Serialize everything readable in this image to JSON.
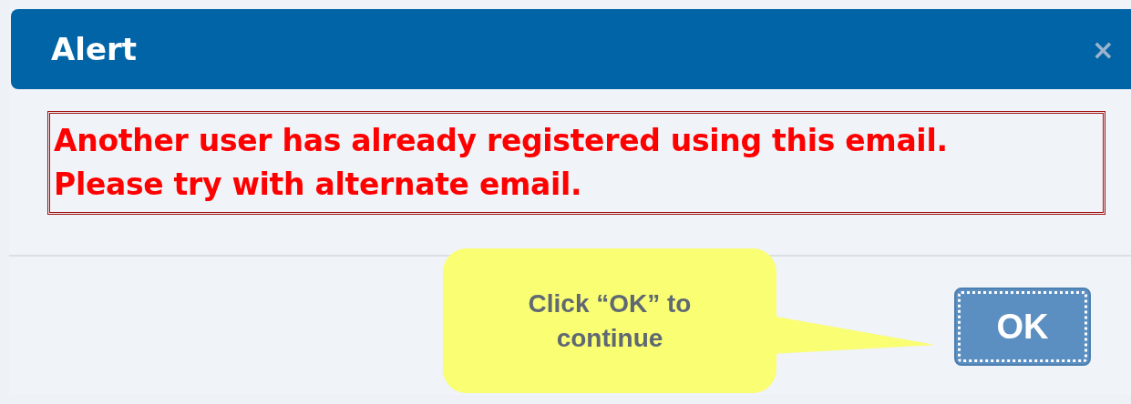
{
  "dialog": {
    "title": "Alert",
    "close": "×",
    "message": "Another user has already registered using this email.\nPlease try with alternate email.",
    "button": "OK",
    "button_focused": true
  },
  "callout": {
    "text": "Click “OK” to continue"
  }
}
